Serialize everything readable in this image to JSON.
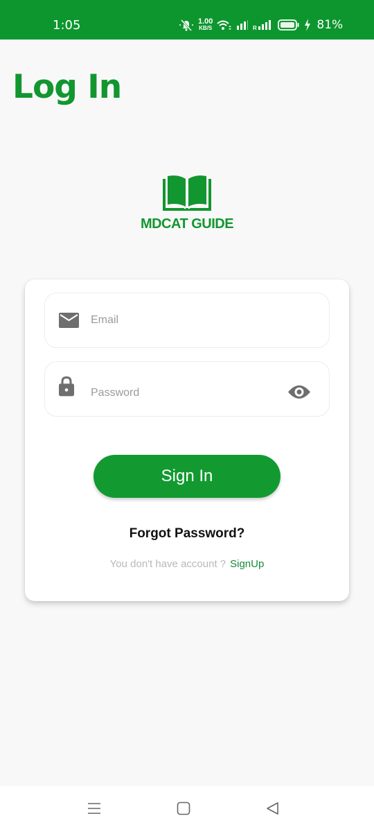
{
  "status_bar": {
    "time": "1:05",
    "net_speed_value": "1.00",
    "net_speed_unit": "KB/S",
    "battery_percent": "81%",
    "icons": [
      "mute-icon",
      "wifi-icon",
      "signal-icon",
      "roaming-signal-icon",
      "battery-icon",
      "charging-icon"
    ]
  },
  "header": {
    "title": "Log In"
  },
  "logo": {
    "text": "MDCAT GUIDE",
    "icon": "open-book-icon"
  },
  "form": {
    "email": {
      "placeholder": "Email",
      "value": "",
      "icon": "mail-icon"
    },
    "password": {
      "placeholder": "Password",
      "value": "",
      "icon": "lock-icon",
      "toggle_icon": "eye-icon"
    },
    "signin_label": "Sign In",
    "forgot_label": "Forgot Password?",
    "signup_prompt": "You don't have account ?",
    "signup_link": "SignUp"
  },
  "nav_bar": {
    "buttons": [
      "menu",
      "home",
      "back"
    ]
  },
  "colors": {
    "brand": "#12962f",
    "status_bar": "#0d962e",
    "link": "#168a3a"
  }
}
